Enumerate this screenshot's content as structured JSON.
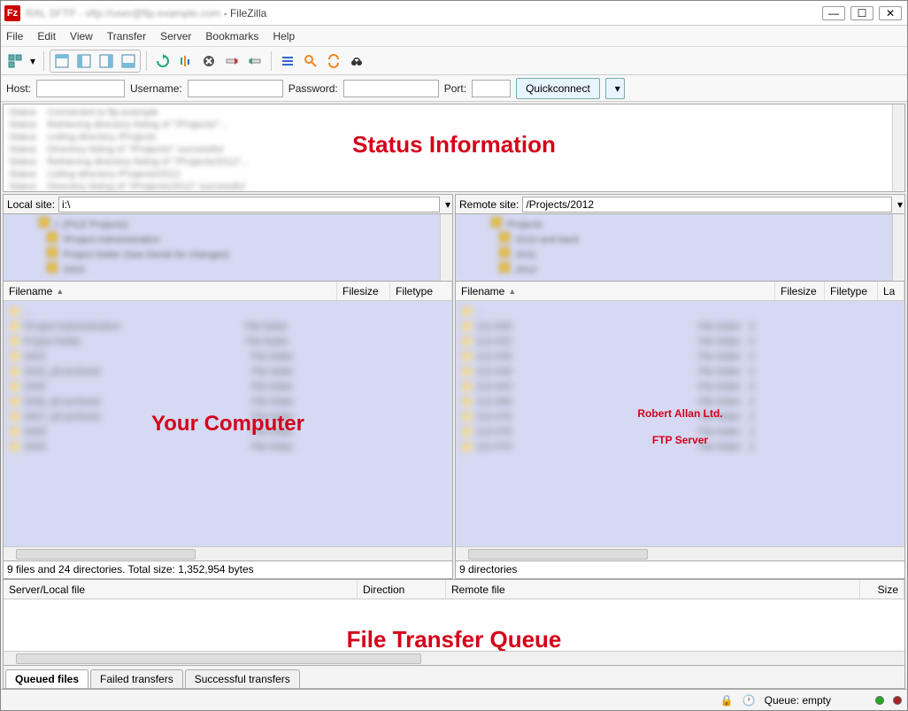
{
  "window": {
    "app_name": "FileZilla",
    "title_separator": " - ",
    "min_label": "—",
    "max_label": "☐",
    "close_label": "✕"
  },
  "menu": {
    "file": "File",
    "edit": "Edit",
    "view": "View",
    "transfer": "Transfer",
    "server": "Server",
    "bookmarks": "Bookmarks",
    "help": "Help"
  },
  "quickconnect": {
    "host_label": "Host:",
    "host_value": "",
    "username_label": "Username:",
    "username_value": "",
    "password_label": "Password:",
    "password_value": "",
    "port_label": "Port:",
    "port_value": "",
    "button": "Quickconnect"
  },
  "annotations": {
    "status": "Status Information",
    "local": "Your Computer",
    "remote": "Robert Allan Ltd. FTP Server",
    "queue": "File Transfer Queue"
  },
  "local": {
    "label": "Local site:",
    "path": "i:\\",
    "columns": {
      "filename": "Filename",
      "filesize": "Filesize",
      "filetype": "Filetype"
    },
    "summary": "9 files and 24 directories. Total size: 1,352,954 bytes"
  },
  "remote": {
    "label": "Remote site:",
    "path": "/Projects/2012",
    "columns": {
      "filename": "Filename",
      "filesize": "Filesize",
      "filetype": "Filetype",
      "last": "La"
    },
    "summary": "9 directories"
  },
  "queue": {
    "columns": {
      "server_local": "Server/Local file",
      "direction": "Direction",
      "remote_file": "Remote file",
      "size": "Size"
    },
    "tabs": {
      "queued": "Queued files",
      "failed": "Failed transfers",
      "successful": "Successful transfers"
    }
  },
  "statusbar": {
    "queue_text": "Queue: empty"
  }
}
